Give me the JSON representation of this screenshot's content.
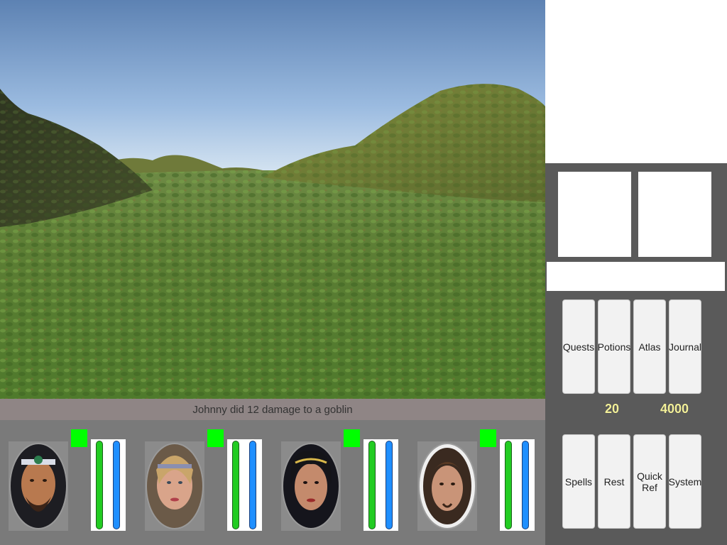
{
  "message_log": {
    "text": "Johnny did 12 damage to a goblin"
  },
  "menu": {
    "top": [
      "Quests",
      "Potions",
      "Atlas",
      "Journal"
    ],
    "bottom": [
      "Spells",
      "Rest",
      "Quick Ref",
      "System"
    ]
  },
  "counters": {
    "first": "20",
    "second": "4000"
  },
  "party": [
    {
      "portrait": "bearded-warrior-portrait",
      "hp_fraction": 1.0,
      "mp_fraction": 1.0
    },
    {
      "portrait": "blonde-woman-portrait",
      "hp_fraction": 1.0,
      "mp_fraction": 1.0
    },
    {
      "portrait": "dark-haired-woman-portrait",
      "hp_fraction": 1.0,
      "mp_fraction": 1.0
    },
    {
      "portrait": "young-man-portrait",
      "hp_fraction": 1.0,
      "mp_fraction": 1.0
    }
  ],
  "colors": {
    "selected": "#00ff00",
    "hp": "#22cc22",
    "mp": "#1f8fff",
    "message_bar": "#8f8585"
  }
}
